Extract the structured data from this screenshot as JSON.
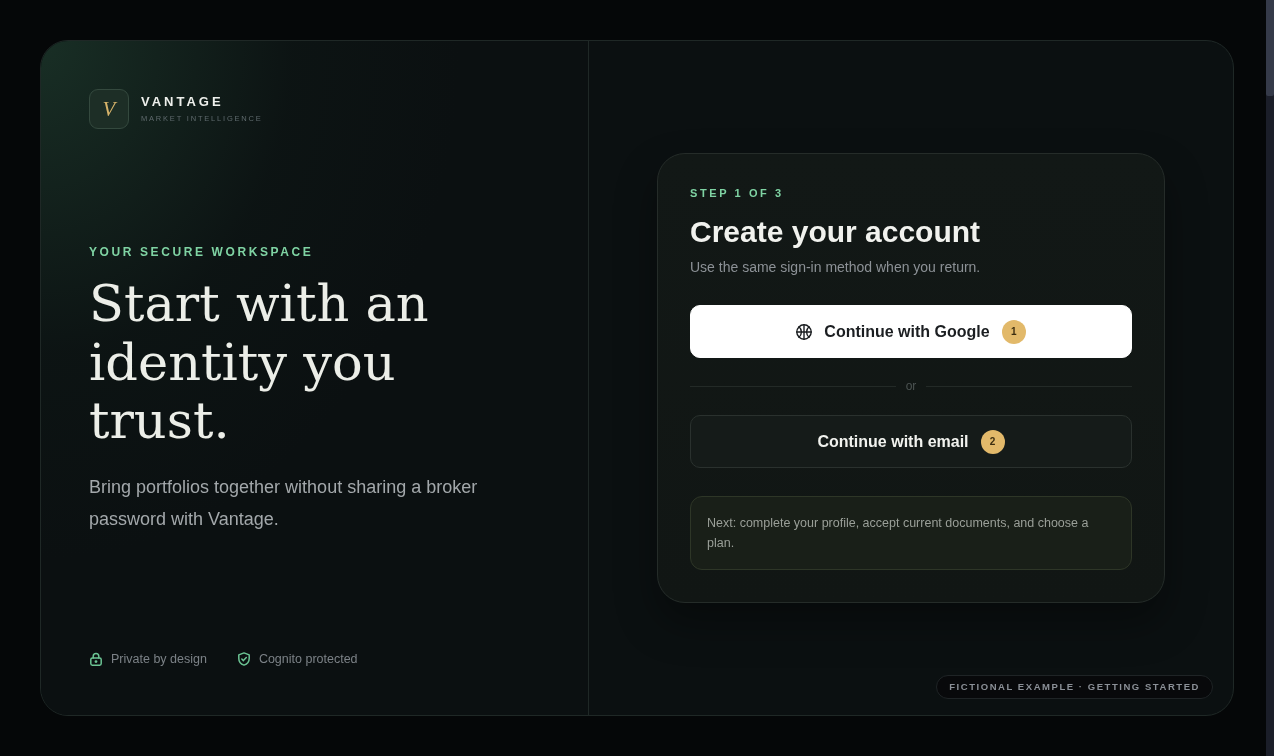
{
  "brand": {
    "logo_letter": "V",
    "name": "VANTAGE",
    "tagline": "MARKET INTELLIGENCE"
  },
  "hero": {
    "eyebrow": "YOUR SECURE WORKSPACE",
    "headline": "Start with an identity you trust.",
    "description": "Bring portfolios together without sharing a broker password with Vantage."
  },
  "trust_badges": [
    {
      "kind": "lock",
      "label": "Private by design"
    },
    {
      "kind": "shield",
      "label": "Cognito protected"
    }
  ],
  "signup": {
    "step": "STEP 1 OF 3",
    "title": "Create your account",
    "subtitle": "Use the same sign-in method when you return.",
    "options": [
      {
        "kind": "google",
        "label": "Continue with Google",
        "badge": "1"
      },
      {
        "kind": "email",
        "label": "Continue with email",
        "badge": "2"
      }
    ],
    "divider": "or",
    "note": "Next: complete your profile, accept current documents, and choose a plan."
  },
  "footer_tag": "FICTIONAL EXAMPLE · GETTING STARTED"
}
